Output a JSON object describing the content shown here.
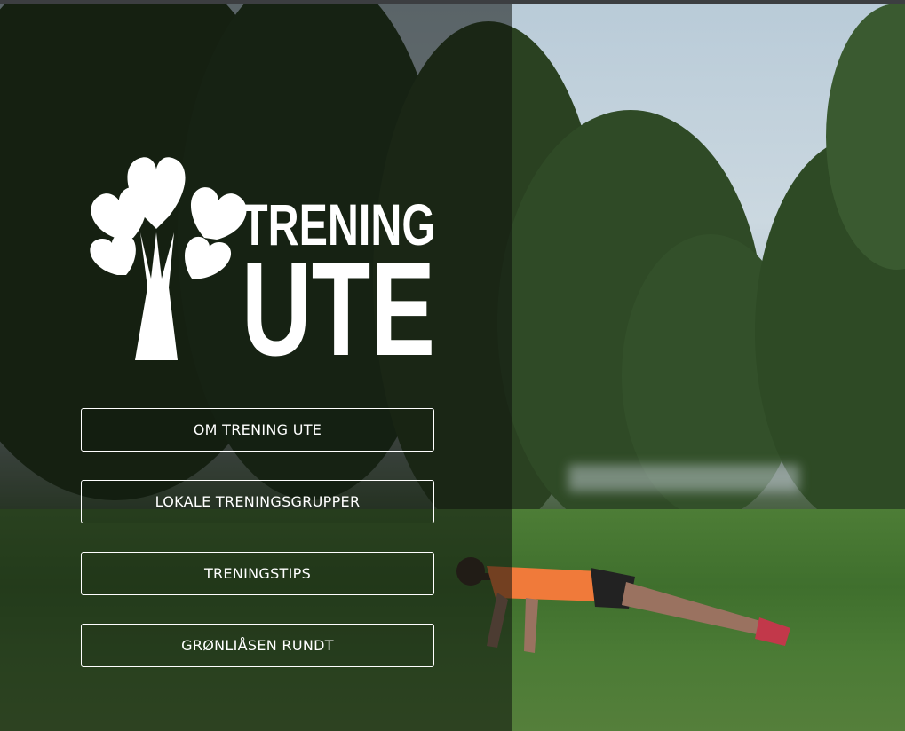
{
  "logo": {
    "line1": "TRENING",
    "line2": "UTE",
    "emblem": "heart-tree-icon"
  },
  "menu": {
    "items": [
      {
        "label": "OM TRENING UTE"
      },
      {
        "label": "LOKALE TRENINGSGRUPPER"
      },
      {
        "label": "TRENINGSTIPS"
      },
      {
        "label": "GRØNLIÅSEN RUNDT"
      }
    ]
  },
  "colors": {
    "text": "#ffffff",
    "overlay": "#0c100c",
    "grass": "#4d7d36"
  }
}
